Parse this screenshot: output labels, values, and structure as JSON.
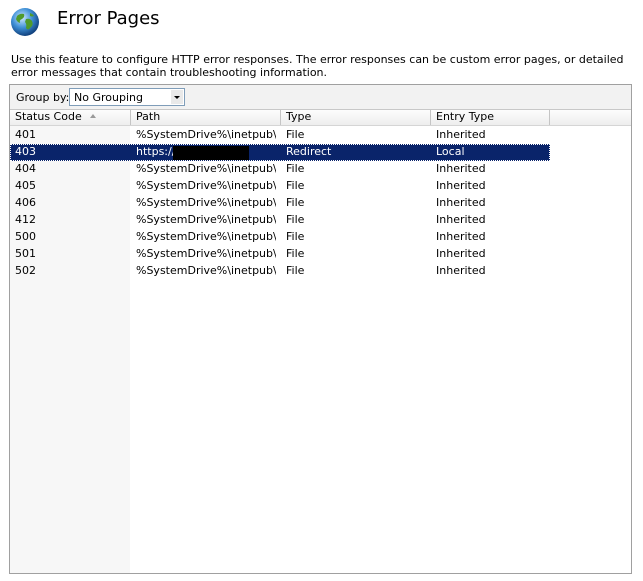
{
  "page": {
    "title": "Error Pages",
    "description": "Use this feature to configure HTTP error responses. The error responses can be custom error pages, or detailed error messages that contain troubleshooting information.",
    "title_icon": "globe-icon"
  },
  "group_by": {
    "label": "Group by:",
    "value": "No Grouping"
  },
  "list": {
    "columns": [
      {
        "label": "Status Code",
        "sorted": "ascending"
      },
      {
        "label": "Path"
      },
      {
        "label": "Type"
      },
      {
        "label": "Entry Type"
      }
    ],
    "selected_row": 1,
    "rows": [
      {
        "code": "401",
        "path": "%SystemDrive%\\inetpub\\...",
        "type": "File",
        "entry": "Inherited"
      },
      {
        "code": "403",
        "path": "https://",
        "type": "Redirect",
        "entry": "Local",
        "path_redacted": true
      },
      {
        "code": "404",
        "path": "%SystemDrive%\\inetpub\\...",
        "type": "File",
        "entry": "Inherited"
      },
      {
        "code": "405",
        "path": "%SystemDrive%\\inetpub\\...",
        "type": "File",
        "entry": "Inherited"
      },
      {
        "code": "406",
        "path": "%SystemDrive%\\inetpub\\...",
        "type": "File",
        "entry": "Inherited"
      },
      {
        "code": "412",
        "path": "%SystemDrive%\\inetpub\\...",
        "type": "File",
        "entry": "Inherited"
      },
      {
        "code": "500",
        "path": "%SystemDrive%\\inetpub\\...",
        "type": "File",
        "entry": "Inherited"
      },
      {
        "code": "501",
        "path": "%SystemDrive%\\inetpub\\...",
        "type": "File",
        "entry": "Inherited"
      },
      {
        "code": "502",
        "path": "%SystemDrive%\\inetpub\\...",
        "type": "File",
        "entry": "Inherited"
      }
    ]
  },
  "colors": {
    "selection": "#0a246a",
    "panel_border": "#a0a0a0"
  }
}
